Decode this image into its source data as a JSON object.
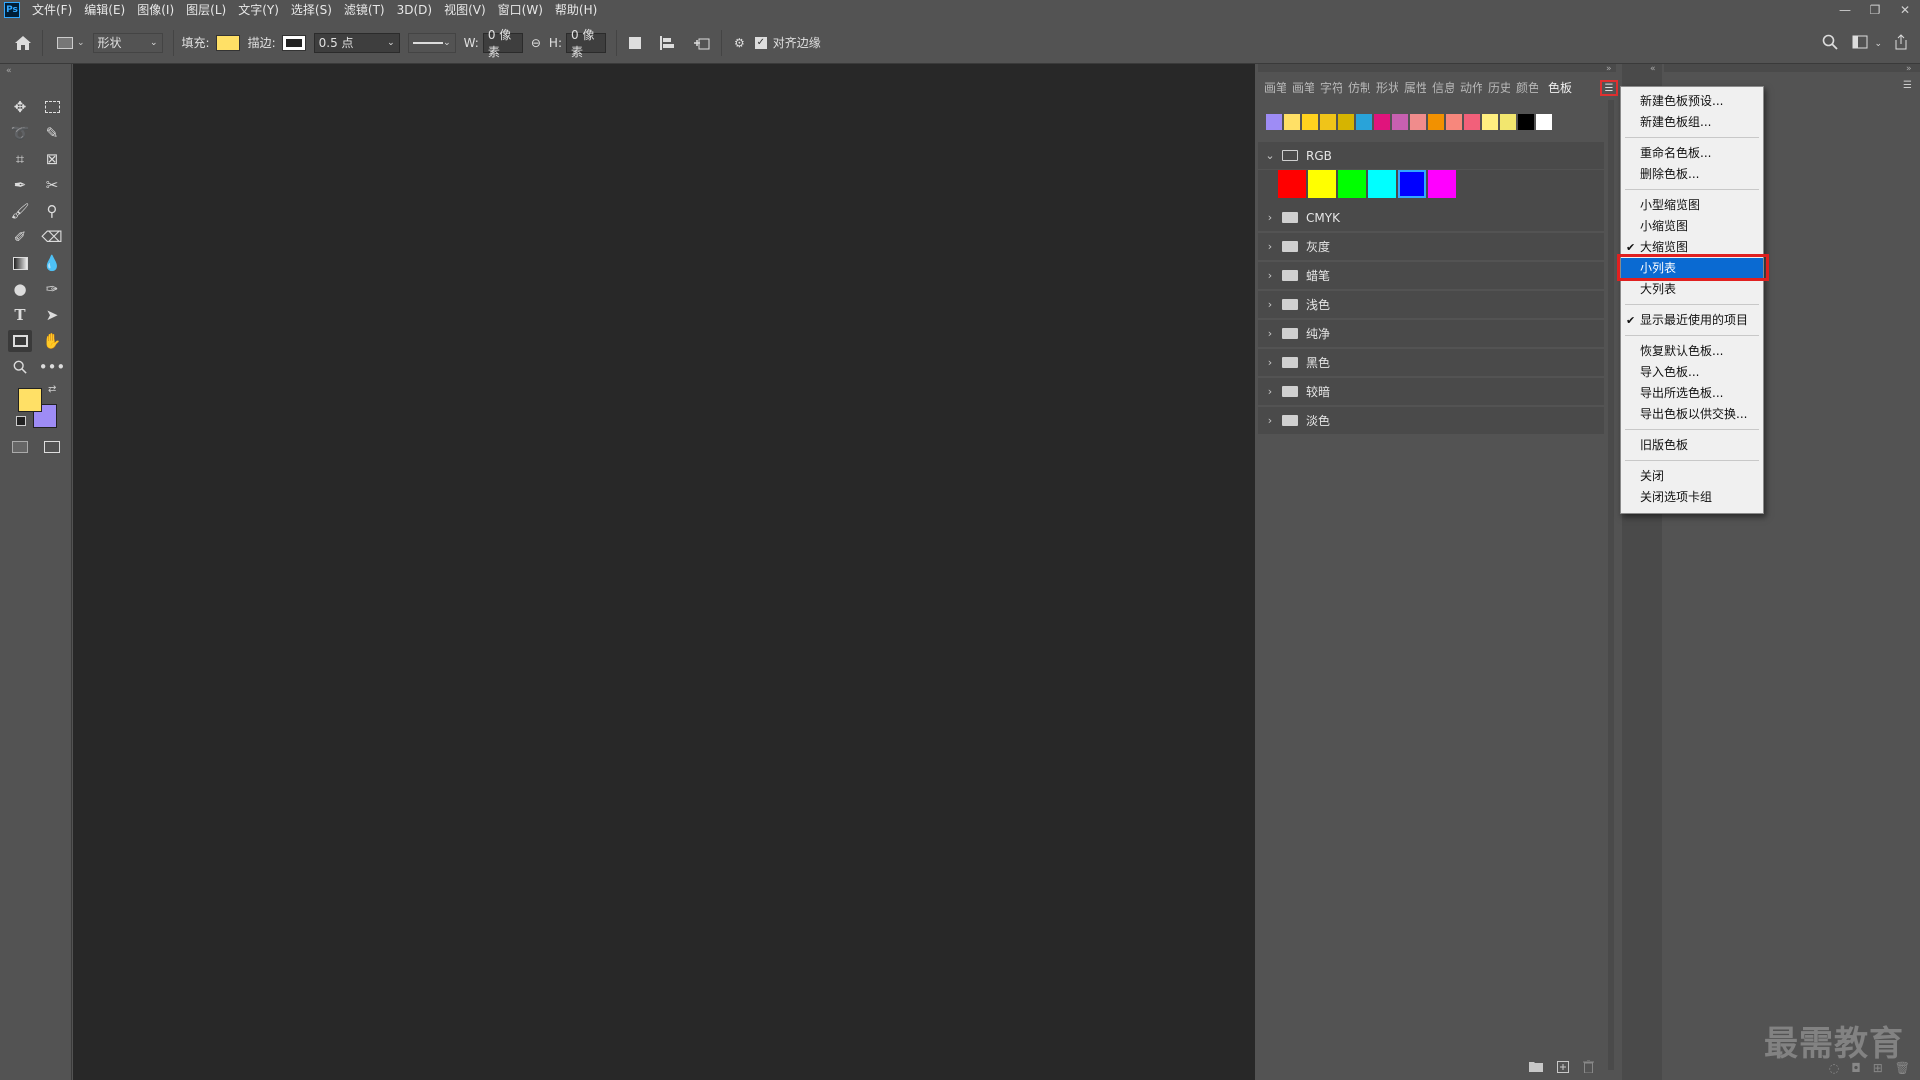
{
  "app": {
    "logo": "Ps"
  },
  "menubar": [
    "文件(F)",
    "编辑(E)",
    "图像(I)",
    "图层(L)",
    "文字(Y)",
    "选择(S)",
    "滤镜(T)",
    "3D(D)",
    "视图(V)",
    "窗口(W)",
    "帮助(H)"
  ],
  "window": {
    "minimize": "—",
    "restore": "❐",
    "close": "✕"
  },
  "options": {
    "mode": "形状",
    "fill_label": "填充:",
    "fill_color": "#ffe066",
    "stroke_label": "描边:",
    "stroke_width": "0.5 点",
    "w_label": "W:",
    "w_value": "0 像素",
    "h_label": "H:",
    "h_value": "0 像素",
    "align_edges": "对齐边缘"
  },
  "toolbar": {
    "foreground": "#ffe066",
    "background": "#9e8cf5"
  },
  "panel": {
    "tabs": [
      "画笔",
      "画笔",
      "字符",
      "仿制",
      "形状",
      "属性",
      "信息",
      "动作",
      "历史",
      "颜色",
      "色板"
    ],
    "active_tab": "色板",
    "recent_swatches": [
      "#9e8cf5",
      "#ffe066",
      "#ffd21f",
      "#f0c419",
      "#d6b400",
      "#29a3d9",
      "#e0147c",
      "#c760b0",
      "#f08c8c",
      "#f29100",
      "#f7877c",
      "#f2607a",
      "#fff080",
      "#f2e66e",
      "#000000",
      "#ffffff"
    ],
    "rgb_group": {
      "name": "RGB",
      "swatches": [
        "#ff0000",
        "#ffff00",
        "#00ff00",
        "#00ffff",
        "#0000ff",
        "#ff00ff"
      ]
    },
    "groups": [
      "CMYK",
      "灰度",
      "蜡笔",
      "浅色",
      "纯净",
      "黑色",
      "较暗",
      "淡色"
    ]
  },
  "dropdown": [
    {
      "label": "新建色板预设...",
      "checked": false
    },
    {
      "label": "新建色板组...",
      "checked": false
    },
    {
      "sep": true
    },
    {
      "label": "重命名色板...",
      "checked": false
    },
    {
      "label": "删除色板...",
      "checked": false
    },
    {
      "sep": true
    },
    {
      "label": "小型缩览图",
      "checked": false
    },
    {
      "label": "小缩览图",
      "checked": false
    },
    {
      "label": "大缩览图",
      "checked": true
    },
    {
      "label": "小列表",
      "checked": false,
      "highlight": true
    },
    {
      "label": "大列表",
      "checked": false
    },
    {
      "sep": true
    },
    {
      "label": "显示最近使用的项目",
      "checked": true
    },
    {
      "sep": true
    },
    {
      "label": "恢复默认色板...",
      "checked": false
    },
    {
      "label": "导入色板...",
      "checked": false
    },
    {
      "label": "导出所选色板...",
      "checked": false
    },
    {
      "label": "导出色板以供交换...",
      "checked": false
    },
    {
      "sep": true
    },
    {
      "label": "旧版色板",
      "checked": false
    },
    {
      "sep": true
    },
    {
      "label": "关闭",
      "checked": false
    },
    {
      "label": "关闭选项卡组",
      "checked": false
    }
  ],
  "watermark": "最需教育"
}
